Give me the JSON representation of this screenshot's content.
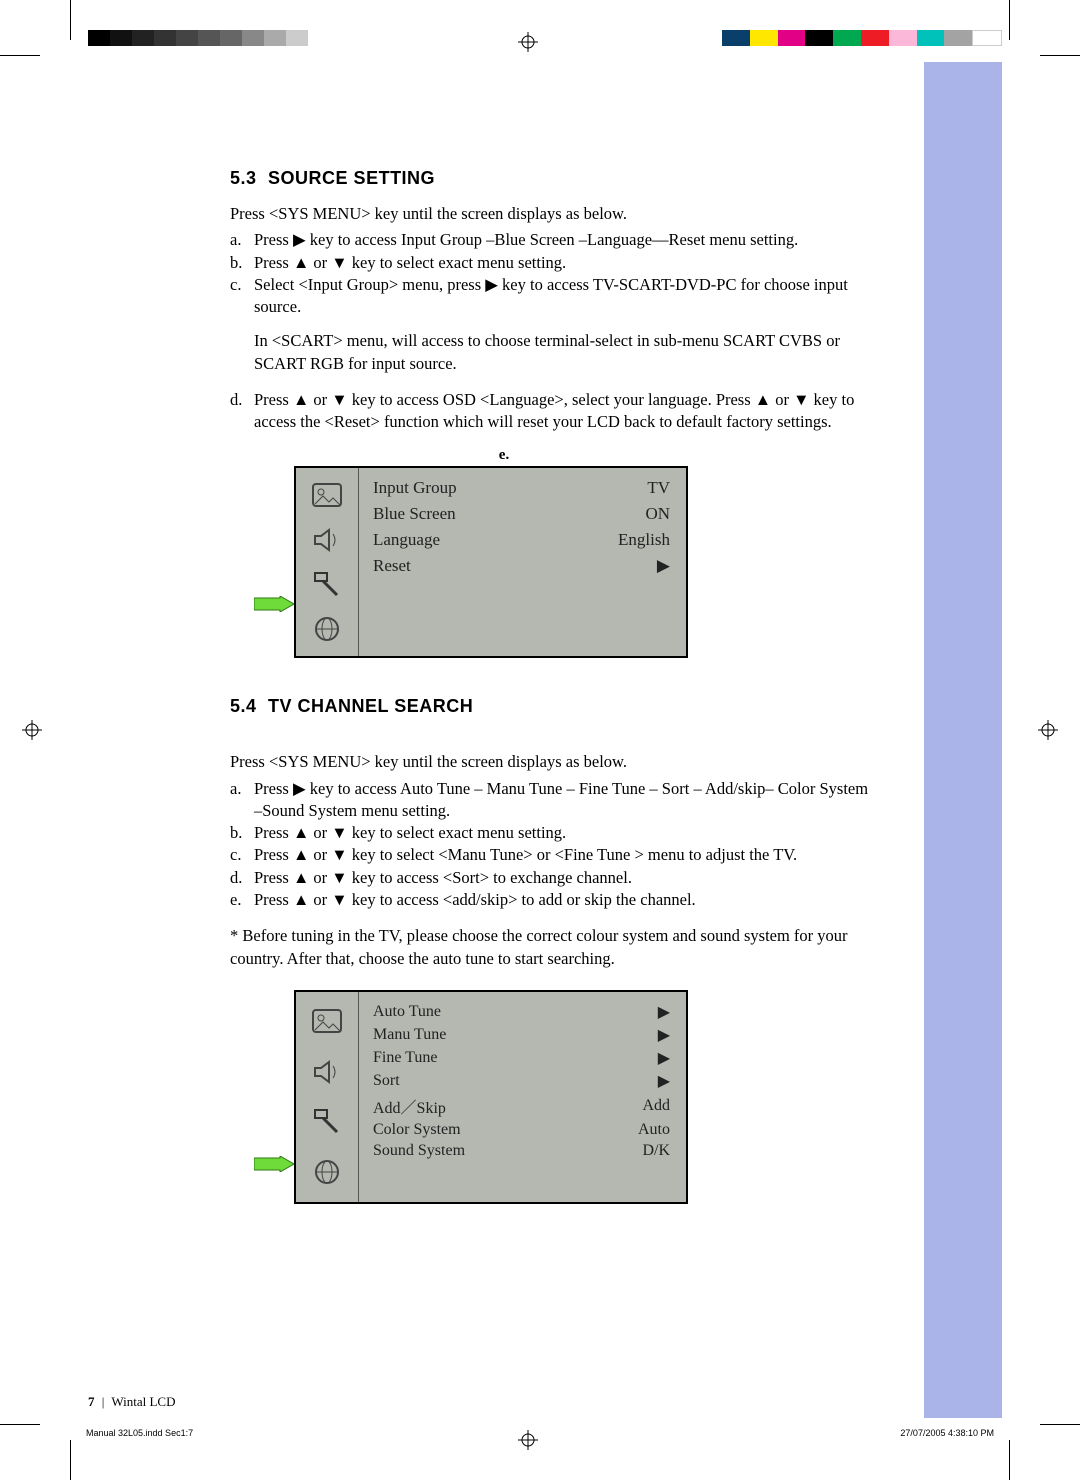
{
  "print": {
    "file_info": "Manual 32L05.indd   Sec1:7",
    "timestamp": "27/07/2005   4:38:10 PM"
  },
  "footer": {
    "page_num": "7",
    "sep": "|",
    "product": "Wintal LCD"
  },
  "section1": {
    "num": "5.3",
    "title": "SOURCE SETTING",
    "intro": "Press <SYS MENU> key until the screen displays as below.",
    "items": [
      "Press ▶ key to access Input Group –Blue Screen –Language—Reset menu setting.",
      "Press ▲ or ▼ key to select exact menu setting.",
      "Select <Input Group> menu, press ▶ key to access TV-SCART-DVD-PC for choose input source."
    ],
    "standalone": "In <SCART> menu, will access to choose terminal-select in sub-menu SCART CVBS or SCART RGB for input source.",
    "item_d": "Press ▲ or ▼ key to access OSD <Language>, select your language. Press ▲ or ▼ key to access the <Reset> function which will reset your LCD back to default factory settings.",
    "fig_label": "e.",
    "osd": {
      "rows": [
        {
          "label": "Input Group",
          "value": "TV"
        },
        {
          "label": "Blue Screen",
          "value": "ON"
        },
        {
          "label": "Language",
          "value": "English"
        },
        {
          "label": "Reset",
          "value": "▶"
        }
      ]
    }
  },
  "section2": {
    "num": "5.4",
    "title": "TV CHANNEL SEARCH",
    "intro": "Press <SYS MENU> key until the screen displays as below.",
    "items": [
      "Press ▶ key to access Auto Tune – Manu Tune – Fine Tune – Sort – Add/skip– Color System –Sound System menu setting.",
      "Press ▲ or ▼ key to select exact menu setting.",
      "Press ▲ or ▼ key to select <Manu Tune> or <Fine Tune > menu to adjust the TV.",
      "Press ▲ or ▼ key to access <Sort> to exchange channel.",
      "Press ▲ or ▼ key to access <add/skip> to add or skip the channel."
    ],
    "note": "*  Before tuning in the TV, please choose the correct colour system and sound system for your country. After that, choose the auto tune to start searching.",
    "osd": {
      "rows": [
        {
          "label": "Auto Tune",
          "value": "▶"
        },
        {
          "label": "Manu Tune",
          "value": "▶"
        },
        {
          "label": "Fine Tune",
          "value": "▶"
        },
        {
          "label": "Sort",
          "value": "▶"
        },
        {
          "label": "Add／Skip",
          "value": "Add"
        },
        {
          "label": "Color System",
          "value": "Auto"
        },
        {
          "label": "Sound System",
          "value": "D/K"
        }
      ]
    }
  },
  "markers": [
    "a.",
    "b.",
    "c.",
    "d.",
    "e."
  ]
}
